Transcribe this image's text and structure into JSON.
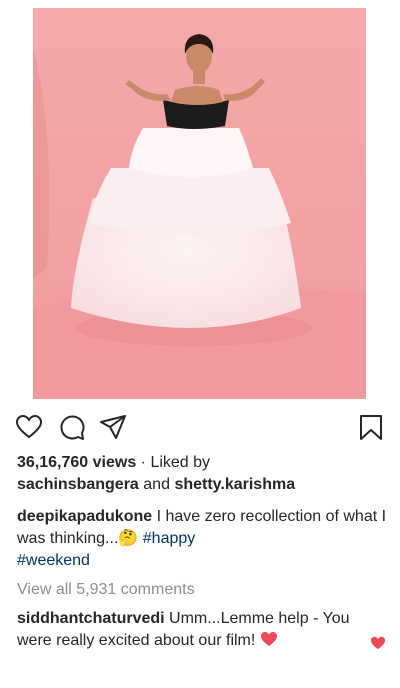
{
  "post": {
    "views_count": "36,16,760 views",
    "liked_by_prefix": "Liked by",
    "liked_by_user1": "sachinsbangera",
    "liked_by_and": "and",
    "liked_by_user2": "shetty.karishma"
  },
  "caption": {
    "username": "deepikapadukone",
    "text": "I have zero recollection of what I was thinking...",
    "emoji": "🤔",
    "hashtag1": "#happy",
    "hashtag2": "#weekend"
  },
  "comments": {
    "view_all": "View all 5,931 comments",
    "items": [
      {
        "username": "siddhantchaturvedi",
        "text": "Umm...Lemme help - You were really excited about our film!"
      }
    ]
  },
  "icons": {
    "like": "heart-outline-icon",
    "comment": "speech-bubble-icon",
    "share": "paper-plane-icon",
    "save": "bookmark-icon",
    "comment_heart": "red-heart-icon"
  },
  "colors": {
    "text": "#262626",
    "muted": "#8e8e8e",
    "hashtag": "#003569",
    "heart": "#ed4956",
    "photo_background": "#f4a6a8"
  }
}
